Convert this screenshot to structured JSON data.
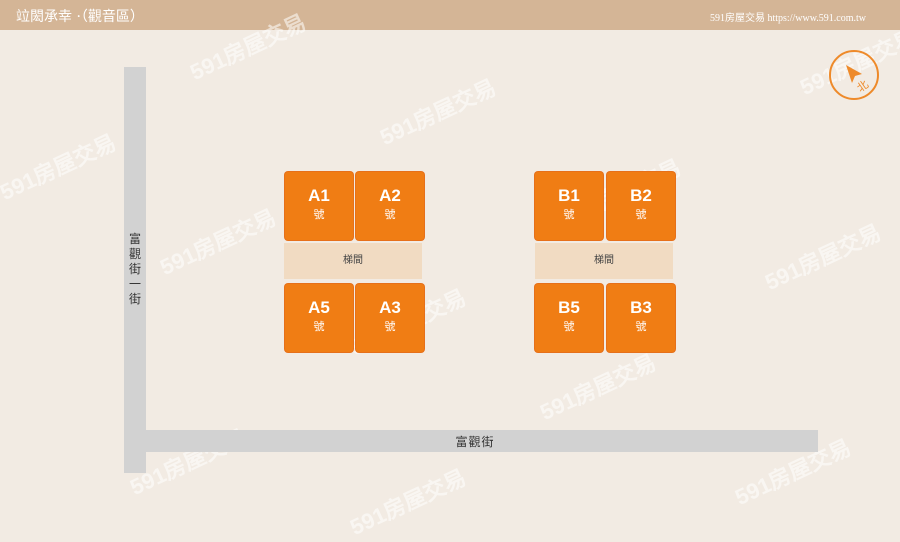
{
  "header": {
    "title": "竝閎承幸 ·（觀音區）",
    "source": "591房屋交易 https://www.591.com.tw"
  },
  "roads": {
    "vertical": "富觀街一街",
    "horizontal": "富觀街"
  },
  "compass": {
    "label": "北"
  },
  "buildings": [
    {
      "units": [
        {
          "code": "A1",
          "suffix": "號"
        },
        {
          "code": "A2",
          "suffix": "號"
        },
        {
          "code": "A5",
          "suffix": "號"
        },
        {
          "code": "A3",
          "suffix": "號"
        }
      ],
      "stair": "梯間"
    },
    {
      "units": [
        {
          "code": "B1",
          "suffix": "號"
        },
        {
          "code": "B2",
          "suffix": "號"
        },
        {
          "code": "B5",
          "suffix": "號"
        },
        {
          "code": "B3",
          "suffix": "號"
        }
      ],
      "stair": "梯間"
    }
  ],
  "watermark": "591房屋交易",
  "colors": {
    "header": "#d4b596",
    "background": "#f2ebe3",
    "unit": "#f07d14",
    "stair": "#f1dbc2",
    "road": "#d2d2d2",
    "compass": "#ee8a2a"
  }
}
